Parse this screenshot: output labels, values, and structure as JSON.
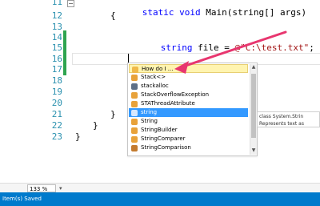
{
  "editor": {
    "line_numbers": [
      "11",
      "12",
      "13",
      "14",
      "15",
      "16",
      "17",
      "18",
      "19",
      "20",
      "21",
      "22",
      "23"
    ],
    "code_lines": {
      "l11_kw": "static void",
      "l11_rest": " Main(string[] args)",
      "l12": "{",
      "l14_kw": "string",
      "l14_mid": " file = ",
      "l14_str": "@\"C:\\test.txt\"",
      "l14_end": ";",
      "l21": "}",
      "l22": "}",
      "l23": "}"
    }
  },
  "intellisense": {
    "items": [
      {
        "label": "How do I ...",
        "icon": "howto-icon"
      },
      {
        "label": "Stack<>",
        "icon": "class-icon"
      },
      {
        "label": "stackalloc",
        "icon": "keyword-icon"
      },
      {
        "label": "StackOverflowException",
        "icon": "class-icon"
      },
      {
        "label": "STAThreadAttribute",
        "icon": "class-icon"
      },
      {
        "label": "string",
        "icon": "keyword-icon"
      },
      {
        "label": "String",
        "icon": "class-icon"
      },
      {
        "label": "StringBuilder",
        "icon": "class-icon"
      },
      {
        "label": "StringComparer",
        "icon": "class-icon"
      },
      {
        "label": "StringComparison",
        "icon": "enum-icon"
      }
    ],
    "selected_index": 5,
    "highlight_index": 0
  },
  "tooltip": {
    "line1": "class System.Strin",
    "line2": "Represents text as"
  },
  "zoom": {
    "value": "133 %",
    "arrow": "▾"
  },
  "status": {
    "text": "Item(s) Saved"
  },
  "colors": {
    "accent": "#007acc",
    "selection": "#3399ff",
    "arrow": "#e8366f",
    "change_bar": "#2ea44f"
  }
}
